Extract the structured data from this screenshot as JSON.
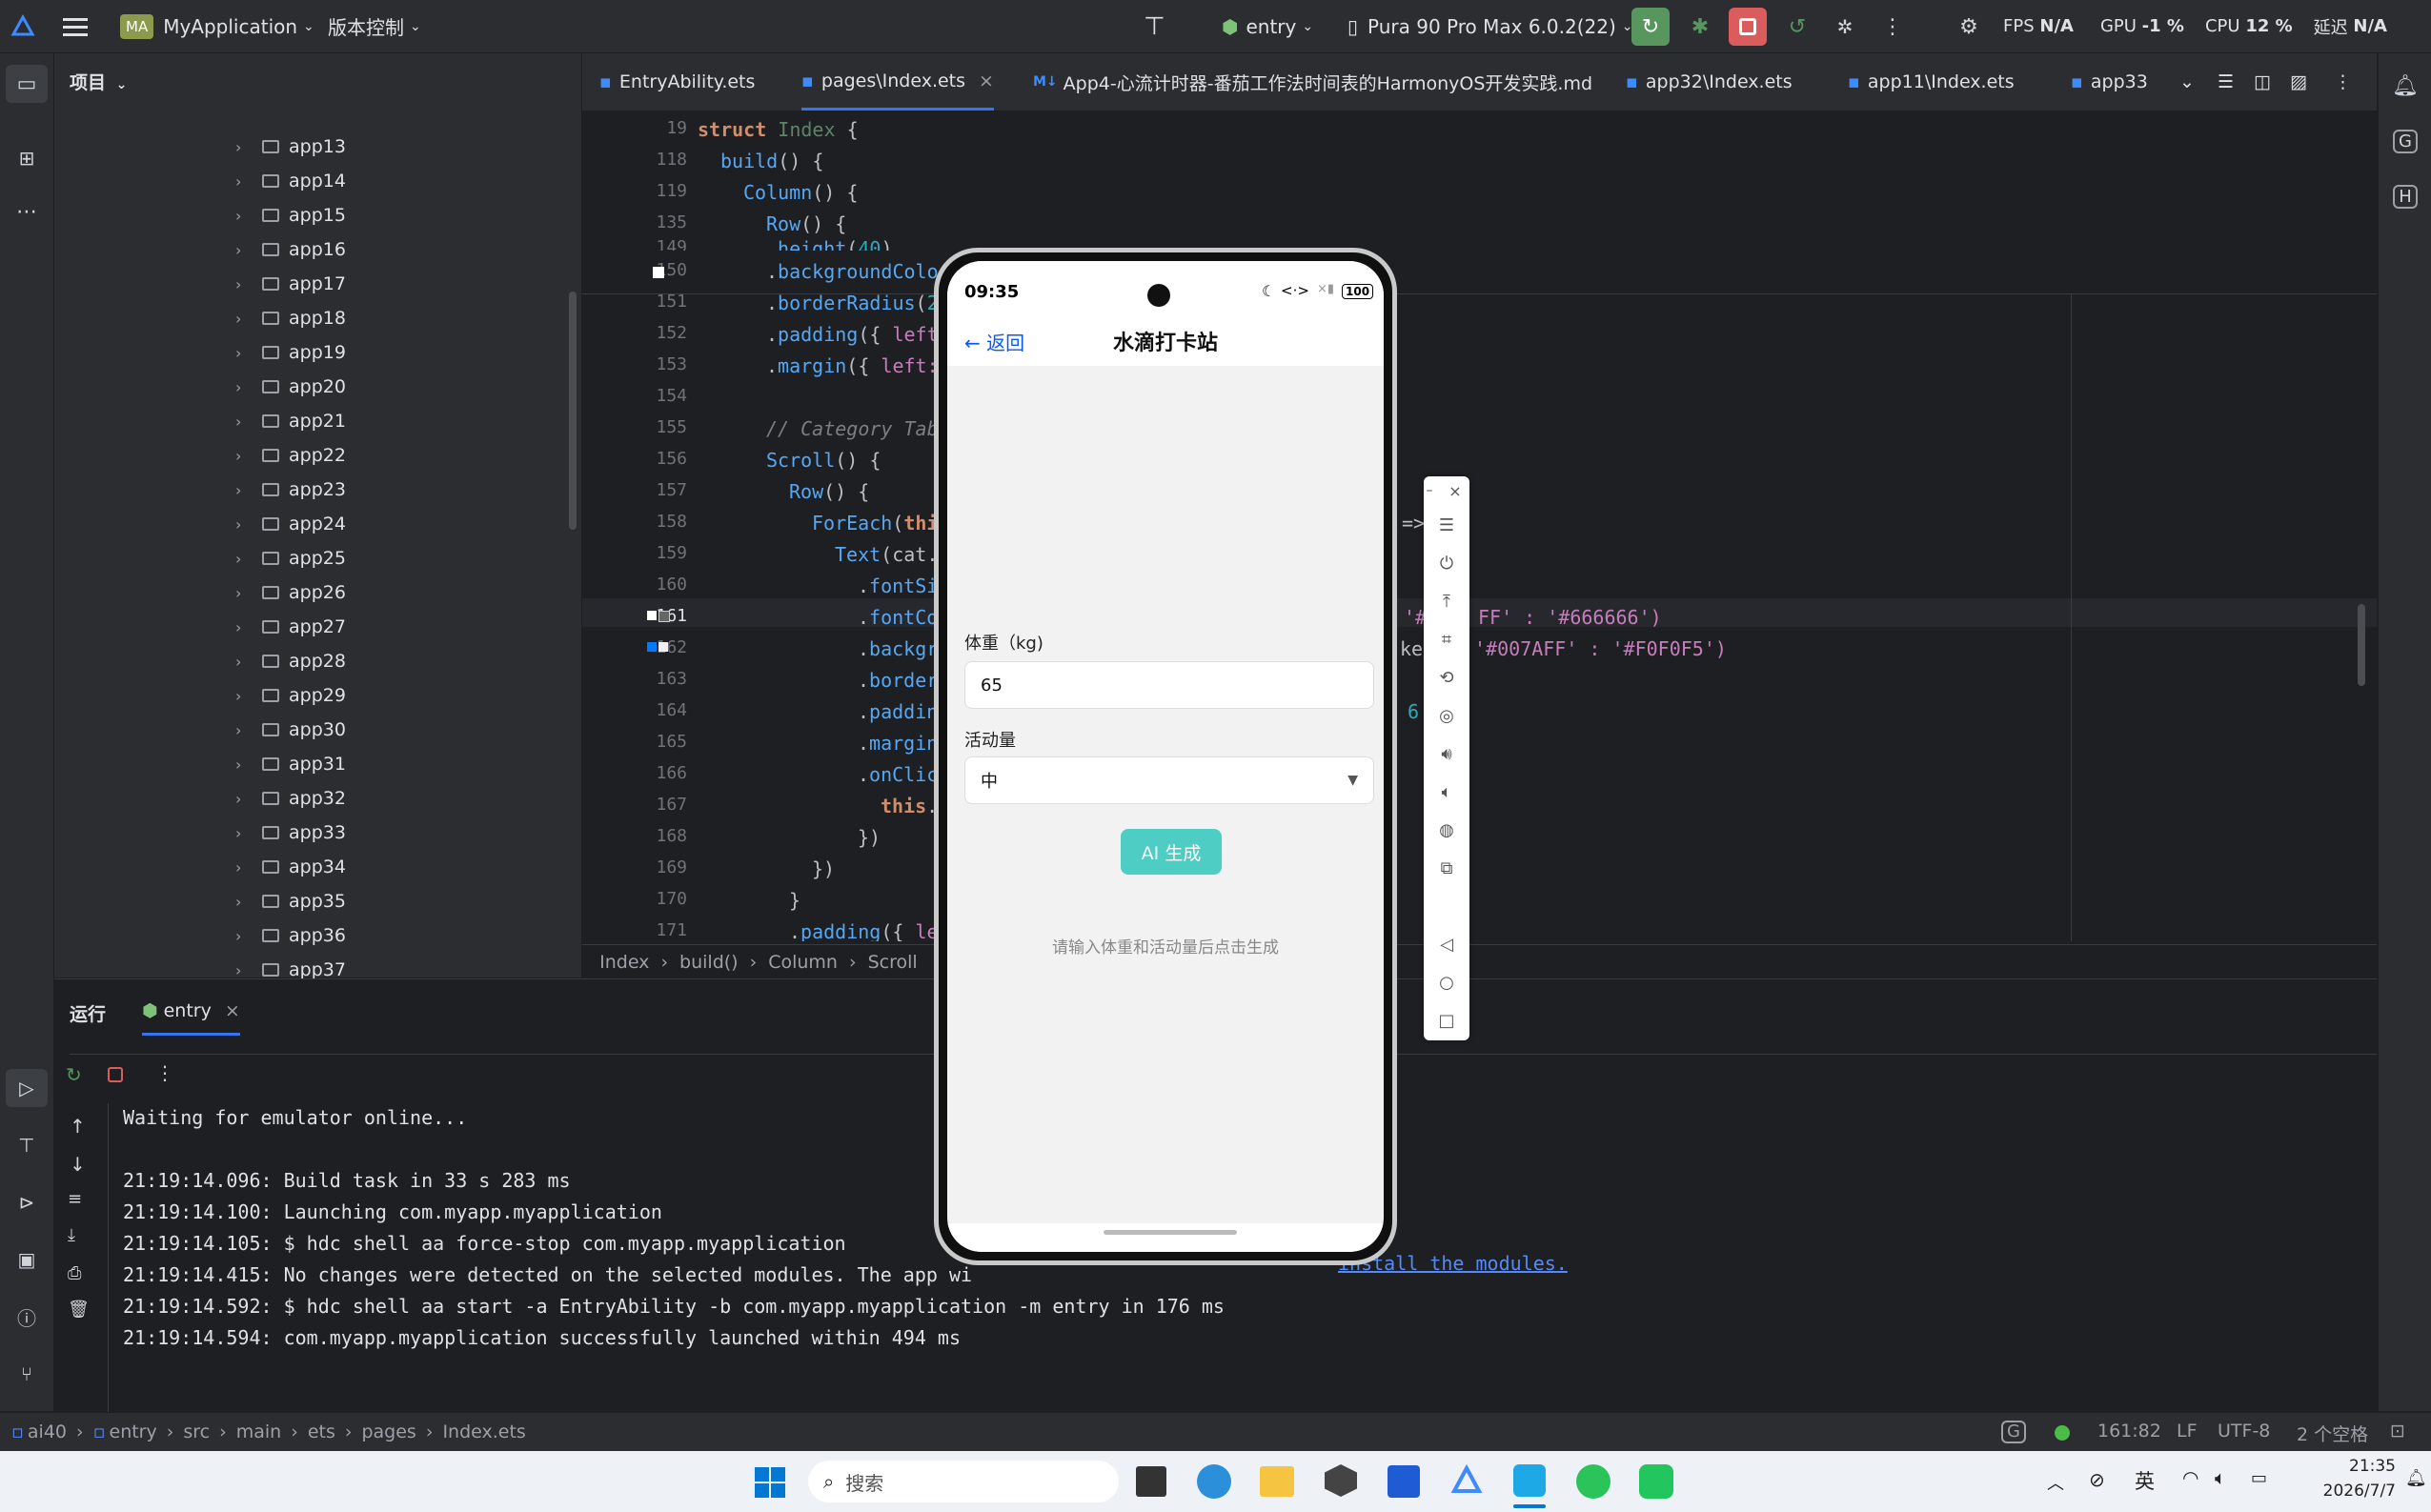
{
  "titlebar": {
    "project_badge": "MA",
    "project_name": "MyApplication",
    "vcs_menu": "版本控制",
    "run_config": "entry",
    "device": "Pura 90 Pro Max 6.0.2(22)",
    "fps_label": "FPS",
    "fps_value": "N/A",
    "gpu_label": "GPU",
    "gpu_value": "-1 %",
    "cpu_label": "CPU",
    "cpu_value": "12 %",
    "latency_label": "延迟",
    "latency_value": "N/A"
  },
  "project_panel": {
    "title": "项目",
    "items": [
      "app13",
      "app14",
      "app15",
      "app16",
      "app17",
      "app18",
      "app19",
      "app20",
      "app21",
      "app22",
      "app23",
      "app24",
      "app25",
      "app26",
      "app27",
      "app28",
      "app29",
      "app30",
      "app31",
      "app32",
      "app33",
      "app34",
      "app35",
      "app36",
      "app37"
    ]
  },
  "editor": {
    "tabs": [
      "EntryAbility.ets",
      "pages\\Index.ets",
      "App4-心流计时器-番茄工作法时间表的HarmonyOS开发实践.md",
      "app32\\Index.ets",
      "app11\\Index.ets",
      "app33"
    ],
    "line_numbers": [
      "19",
      "118",
      "119",
      "135",
      "149",
      "150",
      "151",
      "152",
      "153",
      "154",
      "155",
      "156",
      "157",
      "158",
      "159",
      "160",
      "161",
      "162",
      "163",
      "164",
      "165",
      "166",
      "167",
      "168",
      "169",
      "170",
      "171"
    ],
    "code_right_161": "'#F",
    "code_right_161b": "FF' : '#666666')",
    "code_right_162": "key",
    "code_right_162b": "'#007AFF' : '#F0F0F5')",
    "code_right_158": "=>",
    "code_right_164": "6",
    "breadcrumb": [
      "Index",
      "build()",
      "Column",
      "Scroll"
    ]
  },
  "run_panel": {
    "title": "运行",
    "tab": "entry",
    "logs": [
      "Waiting for emulator online...",
      "",
      "21:19:14.096: Build task in 33 s 283 ms",
      "21:19:14.100: Launching com.myapp.myapplication",
      "21:19:14.105: $ hdc shell aa force-stop com.myapp.myapplication",
      "21:19:14.415: No changes were detected on the selected modules. The app wi",
      "21:19:14.592: $ hdc shell aa start -a EntryAbility -b com.myapp.myapplication -m entry in 176 ms",
      "21:19:14.594: com.myapp.myapplication successfully launched within 494 ms"
    ],
    "link_text": "install the modules."
  },
  "statusbar": {
    "path": [
      "ai40",
      "entry",
      "src",
      "main",
      "ets",
      "pages",
      "Index.ets"
    ],
    "position": "161:82",
    "line_ending": "LF",
    "encoding": "UTF-8",
    "indent": "2 个空格"
  },
  "phone": {
    "time": "09:35",
    "battery": "100",
    "back_label": "返回",
    "page_title": "水滴打卡站",
    "weight_label": "体重（kg)",
    "weight_value": "65",
    "activity_label": "活动量",
    "activity_value": "中",
    "generate_button": "AI 生成",
    "hint": "请输入体重和活动量后点击生成"
  },
  "taskbar": {
    "search_placeholder": "搜索",
    "ime": "英",
    "time": "21:35",
    "date": "2026/7/7"
  },
  "colors": {
    "accent_teal": "#4ecdc4",
    "ide_bg": "#1e1f22",
    "panel_bg": "#2b2d30",
    "run_green": "#57965c",
    "stop_red": "#db5c5c"
  }
}
